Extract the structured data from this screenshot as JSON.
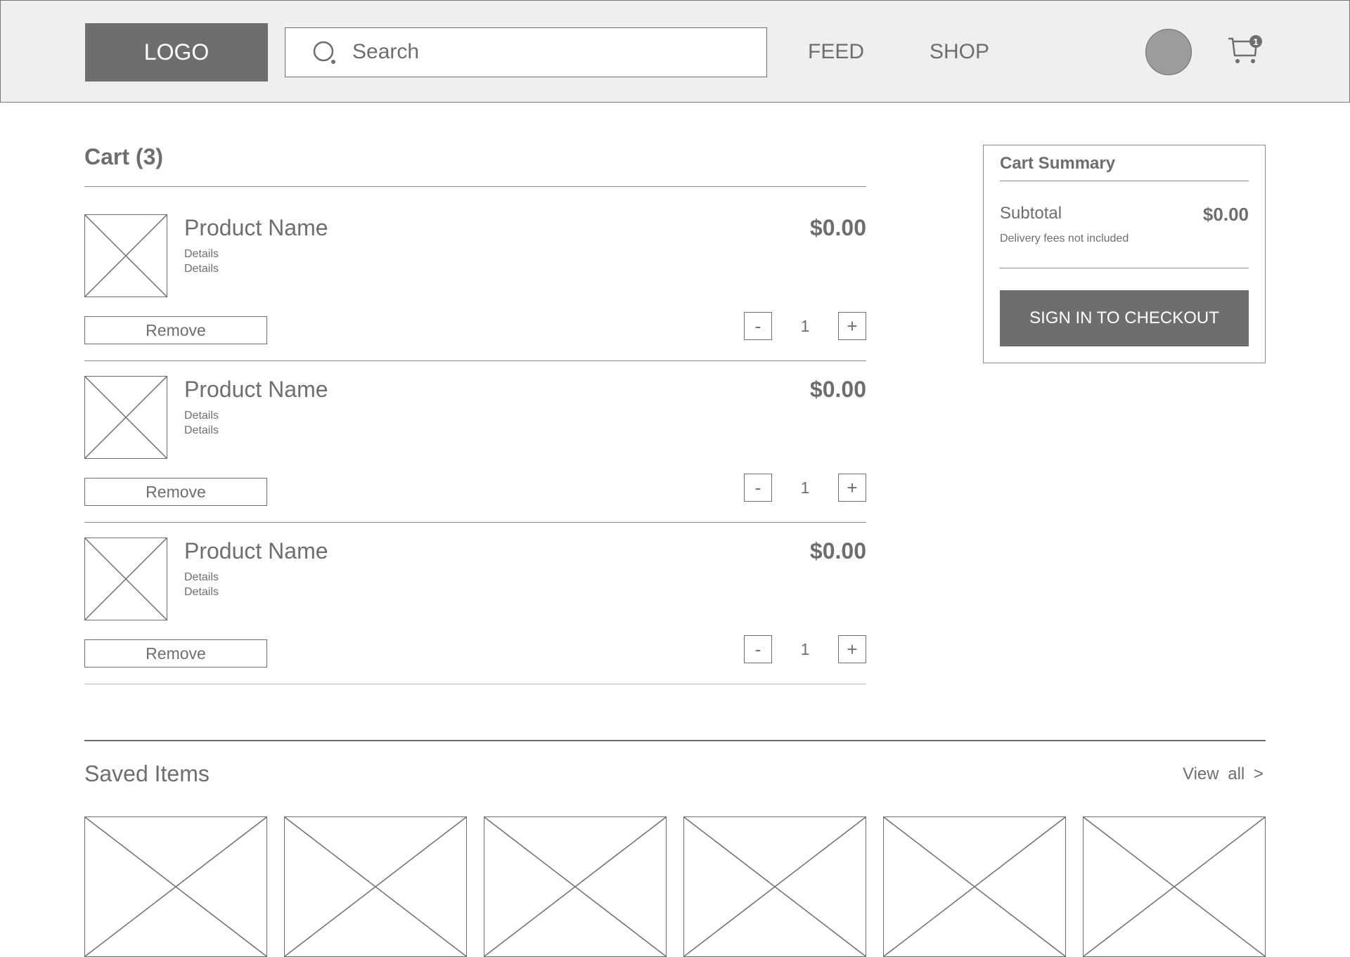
{
  "header": {
    "logo": "LOGO",
    "search_placeholder": "Search",
    "nav": [
      "FEED",
      "SHOP"
    ],
    "cart_badge": "1"
  },
  "cart": {
    "title": "Cart (3)",
    "items": [
      {
        "name": "Product Name",
        "details": [
          "Details",
          "Details"
        ],
        "price": "$0.00",
        "quantity": "1",
        "remove_label": "Remove",
        "minus_label": "-",
        "plus_label": "+"
      },
      {
        "name": "Product Name",
        "details": [
          "Details",
          "Details"
        ],
        "price": "$0.00",
        "quantity": "1",
        "remove_label": "Remove",
        "minus_label": "-",
        "plus_label": "+"
      },
      {
        "name": "Product Name",
        "details": [
          "Details",
          "Details"
        ],
        "price": "$0.00",
        "quantity": "1",
        "remove_label": "Remove",
        "minus_label": "-",
        "plus_label": "+"
      }
    ]
  },
  "summary": {
    "title": "Cart Summary",
    "subtotal_label": "Subtotal",
    "subtotal_value": "$0.00",
    "note": "Delivery fees not included",
    "checkout_label": "SIGN IN TO CHECKOUT"
  },
  "saved": {
    "title": "Saved Items",
    "view_all": "View all >"
  },
  "colors": {
    "header_bg": "#efefef",
    "dark_gray": "#6e6e6e",
    "avatar": "#9c9c9c"
  }
}
